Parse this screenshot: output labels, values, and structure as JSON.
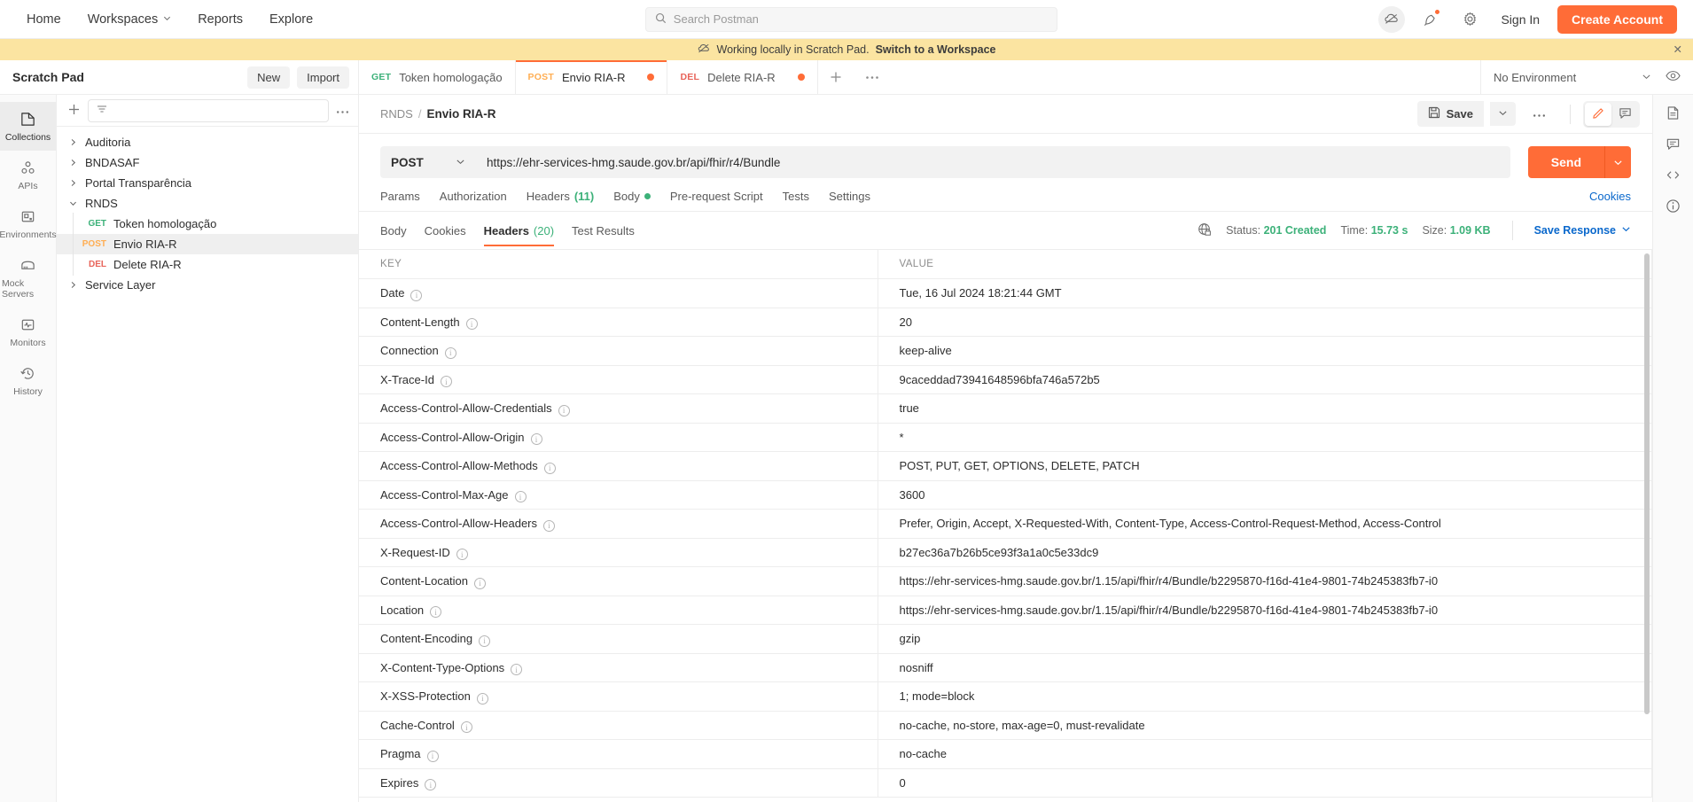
{
  "topnav": {
    "items": [
      {
        "label": "Home",
        "caret": false
      },
      {
        "label": "Workspaces",
        "caret": true
      },
      {
        "label": "Reports",
        "caret": false
      },
      {
        "label": "Explore",
        "caret": false
      }
    ],
    "search_placeholder": "Search Postman",
    "sign_in": "Sign In",
    "create_account": "Create Account",
    "accent": "#ff6c37"
  },
  "banner": {
    "text": "Working locally in Scratch Pad.",
    "link": "Switch to a Workspace",
    "close": "✕",
    "background": "#fbe4a1"
  },
  "workspace": {
    "title": "Scratch Pad",
    "new_button": "New",
    "import_button": "Import"
  },
  "tabs": [
    {
      "method": "GET",
      "label": "Token homologação",
      "unsaved": false,
      "active": false
    },
    {
      "method": "POST",
      "label": "Envio RIA-R",
      "unsaved": true,
      "active": true
    },
    {
      "method": "DEL",
      "label": "Delete RIA-R",
      "unsaved": true,
      "active": false
    }
  ],
  "environment": {
    "selected": "No Environment"
  },
  "rail": [
    {
      "label": "Collections",
      "icon": "collections-icon",
      "active": true
    },
    {
      "label": "APIs",
      "icon": "apis-icon",
      "active": false
    },
    {
      "label": "Environments",
      "icon": "environments-icon",
      "active": false
    },
    {
      "label": "Mock Servers",
      "icon": "mock-servers-icon",
      "active": false
    },
    {
      "label": "Monitors",
      "icon": "monitors-icon",
      "active": false
    },
    {
      "label": "History",
      "icon": "history-icon",
      "active": false
    }
  ],
  "explorer": {
    "filter_placeholder": "",
    "tree": [
      {
        "label": "Auditoria",
        "type": "folder",
        "expanded": false,
        "method": "",
        "selected": false
      },
      {
        "label": "BNDASAF",
        "type": "folder",
        "expanded": false,
        "method": "",
        "selected": false
      },
      {
        "label": "Portal Transparência",
        "type": "folder",
        "expanded": false,
        "method": "",
        "selected": false
      },
      {
        "label": "RNDS",
        "type": "folder",
        "expanded": true,
        "method": "",
        "selected": false
      },
      {
        "label": "Token homologação",
        "type": "request",
        "expanded": false,
        "method": "GET",
        "selected": false
      },
      {
        "label": "Envio RIA-R",
        "type": "request",
        "expanded": false,
        "method": "POST",
        "selected": true
      },
      {
        "label": "Delete RIA-R",
        "type": "request",
        "expanded": false,
        "method": "DEL",
        "selected": false
      },
      {
        "label": "Service Layer",
        "type": "folder",
        "expanded": false,
        "method": "",
        "selected": false
      }
    ]
  },
  "request": {
    "breadcrumb_root": "RNDS",
    "breadcrumb_current": "Envio RIA-R",
    "save_label": "Save",
    "method": "POST",
    "url": "https://ehr-services-hmg.saude.gov.br/api/fhir/r4/Bundle",
    "send_label": "Send",
    "tabs": [
      {
        "label": "Params",
        "count": "",
        "dot": false
      },
      {
        "label": "Authorization",
        "count": "",
        "dot": false
      },
      {
        "label": "Headers",
        "count": "(11)",
        "dot": false
      },
      {
        "label": "Body",
        "count": "",
        "dot": true
      },
      {
        "label": "Pre-request Script",
        "count": "",
        "dot": false
      },
      {
        "label": "Tests",
        "count": "",
        "dot": false
      },
      {
        "label": "Settings",
        "count": "",
        "dot": false
      }
    ],
    "cookies_link": "Cookies"
  },
  "response": {
    "tabs": [
      {
        "label": "Body",
        "count": "",
        "active": false
      },
      {
        "label": "Cookies",
        "count": "",
        "active": false
      },
      {
        "label": "Headers",
        "count": "(20)",
        "active": true
      },
      {
        "label": "Test Results",
        "count": "",
        "active": false
      }
    ],
    "status_label": "Status:",
    "status_value": "201 Created",
    "time_label": "Time:",
    "time_value": "15.73 s",
    "size_label": "Size:",
    "size_value": "1.09 KB",
    "save_response": "Save Response",
    "columns": {
      "key": "KEY",
      "value": "VALUE"
    },
    "headers": [
      {
        "key": "Date",
        "value": "Tue, 16 Jul 2024 18:21:44 GMT"
      },
      {
        "key": "Content-Length",
        "value": "20"
      },
      {
        "key": "Connection",
        "value": "keep-alive"
      },
      {
        "key": "X-Trace-Id",
        "value": "9caceddad73941648596bfa746a572b5"
      },
      {
        "key": "Access-Control-Allow-Credentials",
        "value": "true"
      },
      {
        "key": "Access-Control-Allow-Origin",
        "value": "*"
      },
      {
        "key": "Access-Control-Allow-Methods",
        "value": "POST, PUT, GET, OPTIONS, DELETE, PATCH"
      },
      {
        "key": "Access-Control-Max-Age",
        "value": "3600"
      },
      {
        "key": "Access-Control-Allow-Headers",
        "value": "Prefer, Origin, Accept, X-Requested-With, Content-Type, Access-Control-Request-Method, Access-Control"
      },
      {
        "key": "X-Request-ID",
        "value": "b27ec36a7b26b5ce93f3a1a0c5e33dc9"
      },
      {
        "key": "Content-Location",
        "value": "https://ehr-services-hmg.saude.gov.br/1.15/api/fhir/r4/Bundle/b2295870-f16d-41e4-9801-74b245383fb7-i0"
      },
      {
        "key": "Location",
        "value": "https://ehr-services-hmg.saude.gov.br/1.15/api/fhir/r4/Bundle/b2295870-f16d-41e4-9801-74b245383fb7-i0"
      },
      {
        "key": "Content-Encoding",
        "value": "gzip"
      },
      {
        "key": "X-Content-Type-Options",
        "value": "nosniff"
      },
      {
        "key": "X-XSS-Protection",
        "value": "1; mode=block"
      },
      {
        "key": "Cache-Control",
        "value": "no-cache, no-store, max-age=0, must-revalidate"
      },
      {
        "key": "Pragma",
        "value": "no-cache"
      },
      {
        "key": "Expires",
        "value": "0"
      }
    ]
  }
}
